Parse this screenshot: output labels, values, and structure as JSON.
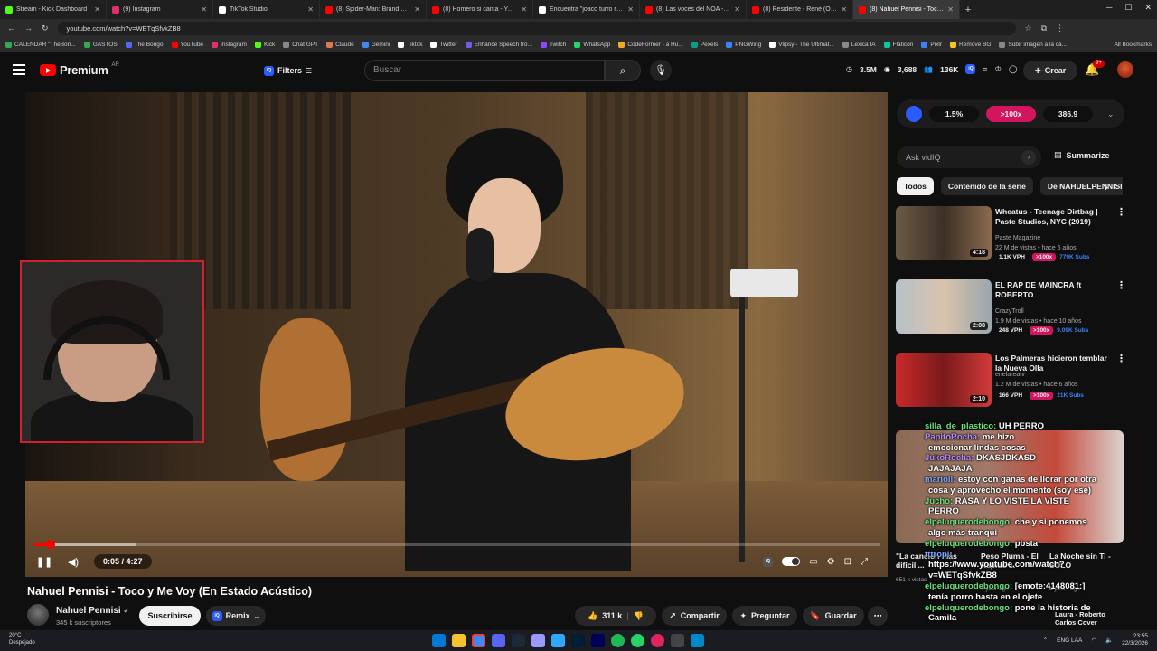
{
  "browser": {
    "tabs": [
      {
        "title": "Stream - Kick Dashboard",
        "color": "#53fc18",
        "active": false
      },
      {
        "title": "(9) Instagram",
        "color": "#e1306c",
        "active": false
      },
      {
        "title": "TikTok Studio",
        "color": "#ffffff",
        "active": false
      },
      {
        "title": "(8) Spider-Man: Brand New Da",
        "color": "#ff0000",
        "active": false
      },
      {
        "title": "(8) Homero si canta - YouTube",
        "color": "#ff0000",
        "active": false
      },
      {
        "title": "Encuentra \"joaco turro reacción",
        "color": "#ffffff",
        "active": false
      },
      {
        "title": "(8) Las voces del NOA - Los Hu",
        "color": "#ff0000",
        "active": false
      },
      {
        "title": "(8) Residente - René (Official Vi",
        "color": "#ff0000",
        "active": false
      },
      {
        "title": "(8) Nahuel Pennisi - Toco y",
        "color": "#ff0000",
        "active": true
      }
    ],
    "new_tab": "+",
    "url": "youtube.com/watch?v=WETqSfvkZB8",
    "bookmarks": [
      {
        "label": "CALENDAR \"TheBon...",
        "color": "#34a853"
      },
      {
        "label": "GASTOS",
        "color": "#34a853"
      },
      {
        "label": "The Bongo",
        "color": "#5865f2"
      },
      {
        "label": "YouTube",
        "color": "#ff0000"
      },
      {
        "label": "Instagram",
        "color": "#e1306c"
      },
      {
        "label": "Kick",
        "color": "#53fc18"
      },
      {
        "label": "Chat GPT",
        "color": "#888888"
      },
      {
        "label": "Claude",
        "color": "#d97757"
      },
      {
        "label": "Gemini",
        "color": "#4285f4"
      },
      {
        "label": "Tiktok",
        "color": "#ffffff"
      },
      {
        "label": "Twitter",
        "color": "#ffffff"
      },
      {
        "label": "Enhance Speech fro...",
        "color": "#6c5ce7"
      },
      {
        "label": "Twitch",
        "color": "#9146ff"
      },
      {
        "label": "WhatsApp",
        "color": "#25d366"
      },
      {
        "label": "CodeFormer - a Hu...",
        "color": "#f5a623"
      },
      {
        "label": "Pexels",
        "color": "#05a081"
      },
      {
        "label": "PNGWing",
        "color": "#3b82f6"
      },
      {
        "label": "Vlipsy - The Ultimat...",
        "color": "#ffffff"
      },
      {
        "label": "Lexica IA",
        "color": "#888888"
      },
      {
        "label": "Flaticon",
        "color": "#0cca98"
      },
      {
        "label": "Pixlr",
        "color": "#3b82f6"
      },
      {
        "label": "Remove BG",
        "color": "#f5c518"
      },
      {
        "label": "Subir imagen a la ca...",
        "color": "#888888"
      }
    ],
    "all_bookmarks": "All Bookmarks"
  },
  "header": {
    "logo_word": "Premium",
    "region": "AR",
    "filters_label": "Filters",
    "search_placeholder": "Buscar",
    "stats": [
      {
        "icon": "clock-icon",
        "value": "3.5M"
      },
      {
        "icon": "eye-icon",
        "value": "3,688"
      },
      {
        "icon": "users-icon",
        "value": "136K"
      }
    ],
    "create_label": "Crear",
    "notif_badge": "9+"
  },
  "player": {
    "current_time": "0:05",
    "duration": "4:27",
    "time_text": "0:05 / 4:27",
    "progress": 0.019,
    "buffered": 0.12
  },
  "video": {
    "title": "Nahuel Pennisi - Toco y Me Voy (En Estado Acústico)",
    "channel": "Nahuel Pennisi",
    "subscribers": "345 k suscriptores",
    "subscribe_label": "Suscribirse",
    "remix_label": "Remix",
    "likes": "311 k",
    "share_label": "Compartir",
    "ask_label": "Preguntar",
    "save_label": "Guardar"
  },
  "sidebar": {
    "vidiq_stats": [
      "1.5%",
      ">100x",
      "386.9"
    ],
    "ask_placeholder": "Ask vidIQ",
    "summarize_label": "Summarize",
    "chips": [
      "Todos",
      "Contenido de la serie",
      "De NAHUELPENNISI"
    ],
    "recommendations": [
      {
        "title": "Wheatus - Teenage Dirtbag | Paste Studios, NYC (2019)",
        "channel": "Paste Magazine",
        "meta": "22 M de vistas • hace 6 años",
        "duration": "4:18",
        "vph": "1.1K VPH",
        "outlier": ">100x",
        "subs": "779K Subs"
      },
      {
        "title": "EL RAP DE MAINCRA ft ROBERTO",
        "channel": "CrazyTroll",
        "meta": "1.9 M de vistas • hace 10 años",
        "duration": "2:08",
        "vph": "248 VPH",
        "outlier": ">100x",
        "subs": "9.09K Subs"
      },
      {
        "title": "Los Palmeras hicieron temblar la Nueva Olla",
        "channel": "enelareatv",
        "meta": "1.2 M de vistas • hace 6 años",
        "duration": "2:10",
        "vph": "166 VPH",
        "outlier": ">100x",
        "subs": "21K Subs"
      }
    ]
  },
  "chat_overlay": [
    {
      "user": "silla_de_plastico:",
      "text": "UH PERRO",
      "color": "u"
    },
    {
      "user": "PapitoRocha:",
      "text": "me hizo",
      "color": "u3"
    },
    {
      "user": "",
      "text": "emocionar lindas cosas",
      "color": ""
    },
    {
      "user": "JukoRocha:",
      "text": "DKASJDKASD",
      "color": "u3"
    },
    {
      "user": "",
      "text": "JAJAJAJA",
      "color": ""
    },
    {
      "user": "marioll:",
      "text": "estoy con ganas de llorar por otra",
      "color": "u2"
    },
    {
      "user": "",
      "text": "cosa y aprovecho el momento (soy ese)",
      "color": ""
    },
    {
      "user": "Jucho:",
      "text": "RASA Y LO VISTE LA VISTE",
      "color": "u"
    },
    {
      "user": "",
      "text": "PERRO",
      "color": ""
    },
    {
      "user": "elpeluquerodebongo:",
      "text": "che y si ponemos",
      "color": "u"
    },
    {
      "user": "",
      "text": "algo más tranqui",
      "color": ""
    },
    {
      "user": "elpeluquerodebongo:",
      "text": "pbsta",
      "color": "u"
    },
    {
      "user": "tttropi:",
      "text": "",
      "color": "u2"
    },
    {
      "user": "",
      "text": "https://www.youtube.com/watch?",
      "color": ""
    },
    {
      "user": "",
      "text": "v=WETqSfvkZB8",
      "color": ""
    },
    {
      "user": "elpeluquerodebongo:",
      "text": "[emote:4148081:]",
      "color": "u"
    },
    {
      "user": "",
      "text": "tenía porro hasta en el ojete",
      "color": ""
    },
    {
      "user": "elpeluquerodebongo:",
      "text": "pone la historia de",
      "color": "u"
    },
    {
      "user": "",
      "text": "Camila",
      "color": ""
    }
  ],
  "chat_behind": {
    "reco_a": "\"La cancion más dificil ...",
    "reco_b": "Peso Pluma - El Rapido ...",
    "reco_c": "La Noche sin Ti - SOLO",
    "meta_a": "651 k vistas",
    "meta_b": "1 year ago",
    "meta_c": "4 years ago",
    "reco_d": "Laura - Roberto Carlos Cover"
  },
  "taskbar": {
    "weather_temp": "20°C",
    "weather_desc": "Despejado",
    "lang": "ENG LAA",
    "time": "23:55",
    "date": "22/3/2026"
  }
}
